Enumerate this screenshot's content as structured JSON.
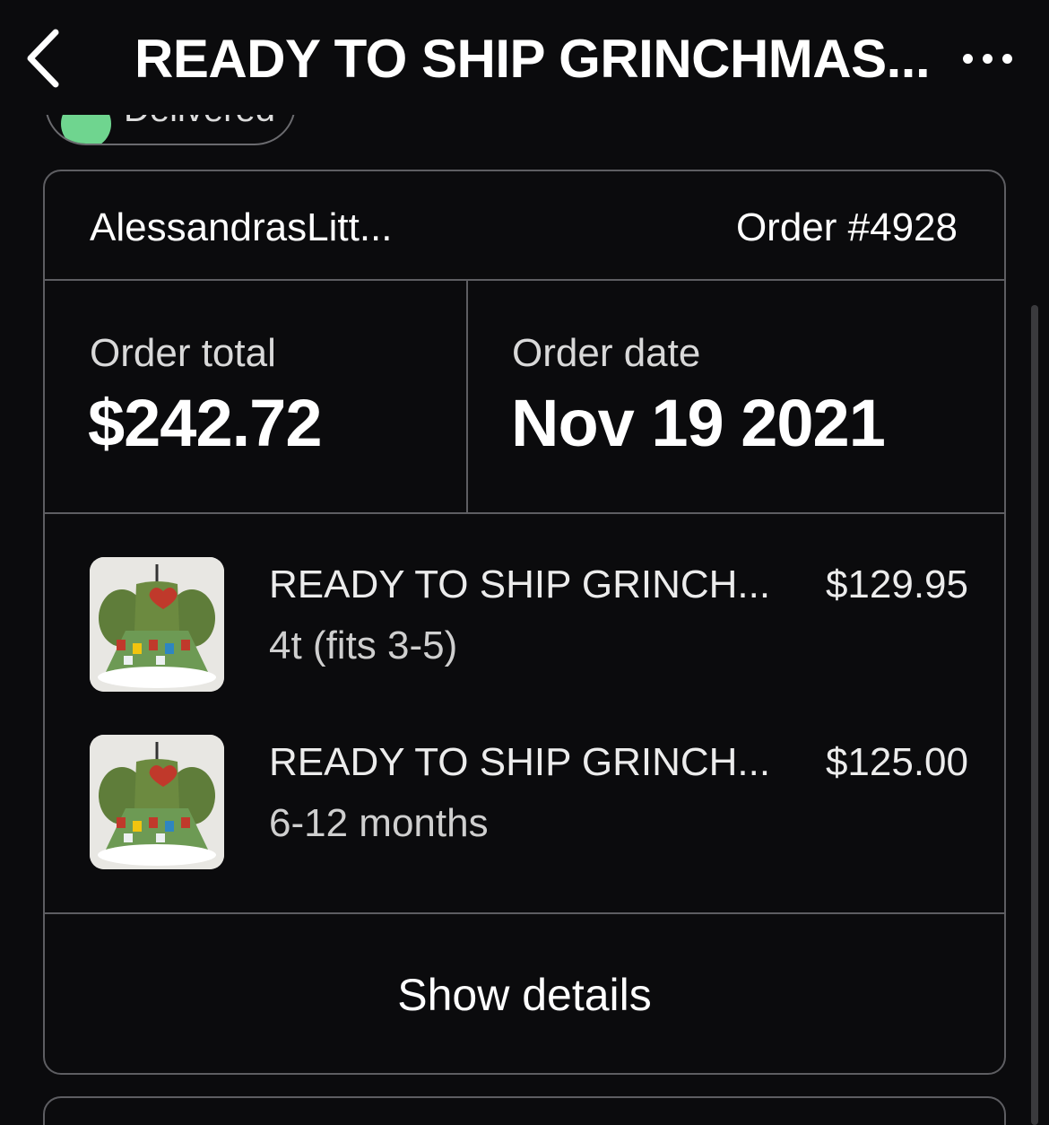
{
  "header": {
    "title": "READY TO SHIP GRINCHMAS...",
    "back_icon": "chevron-left-icon",
    "more_icon": "more-horizontal-icon"
  },
  "status": {
    "label": "Delivered",
    "color": "#6fd58f"
  },
  "order": {
    "shop_name": "AlessandrasLitt...",
    "order_number": "Order #4928",
    "total_label": "Order total",
    "total_value": "$242.72",
    "date_label": "Order date",
    "date_value": "Nov 19 2021"
  },
  "items": [
    {
      "title": "READY TO SHIP GRINCH...",
      "price": "$129.95",
      "variant": "4t (fits 3-5)"
    },
    {
      "title": "READY TO SHIP GRINCH...",
      "price": "$125.00",
      "variant": "6-12 months"
    }
  ],
  "actions": {
    "show_details": "Show details"
  }
}
